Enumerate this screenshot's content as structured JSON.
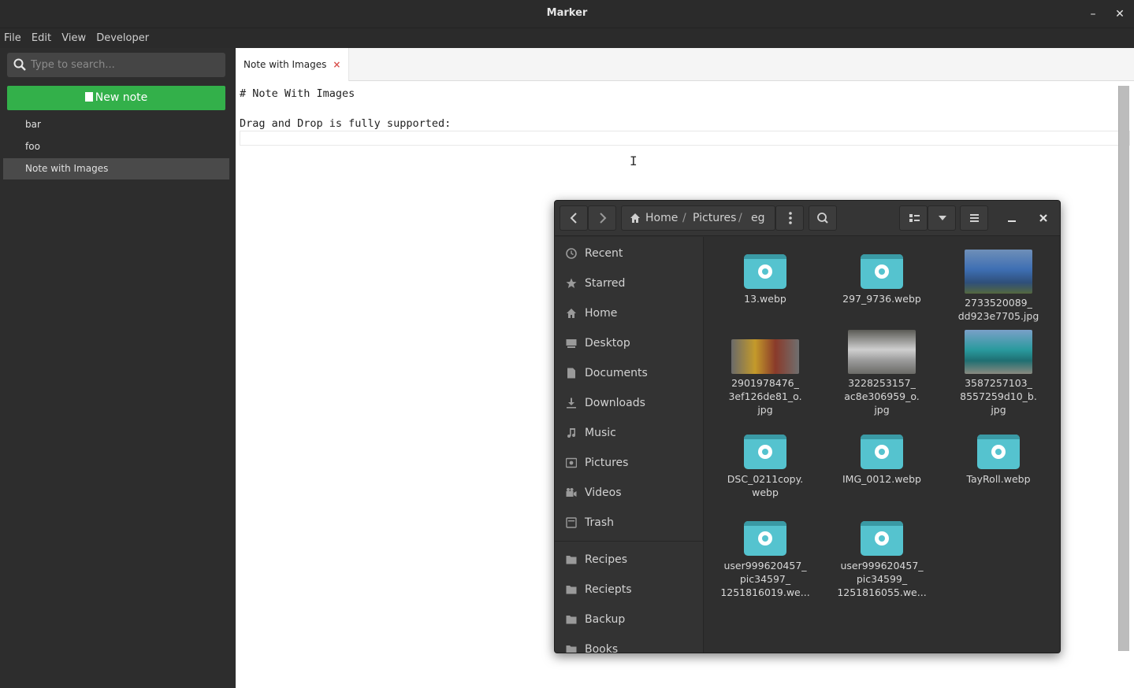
{
  "window": {
    "title": "Marker",
    "minimize_glyph": "–",
    "close_glyph": "✕"
  },
  "menu": [
    "File",
    "Edit",
    "View",
    "Developer"
  ],
  "sidebar": {
    "search_placeholder": "Type to search...",
    "new_note_label": "New note",
    "notes": [
      "bar",
      "foo",
      "Note with Images"
    ],
    "active_note": "Note with Images"
  },
  "tab": {
    "label": "Note with Images",
    "close_glyph": "×"
  },
  "editor": {
    "lines": [
      "# Note With Images",
      "",
      "Drag and Drop is fully supported:"
    ]
  },
  "dialog": {
    "breadcrumbs": [
      "Home",
      "Pictures",
      "eg"
    ],
    "crumb_separator": "/",
    "places": [
      "Recent",
      "Starred",
      "Home",
      "Desktop",
      "Documents",
      "Downloads",
      "Music",
      "Pictures",
      "Videos",
      "Trash"
    ],
    "bookmarks": [
      "Recipes",
      "Reciepts",
      "Backup",
      "Books"
    ],
    "files": [
      {
        "name": "13.webp",
        "kind": "image-icon"
      },
      {
        "name": "297_9736.webp",
        "kind": "image-icon"
      },
      {
        "name": "2733520089_\ndd923e7705.jpg",
        "kind": "thumbnail",
        "color": "#3e6fb3"
      },
      {
        "name": "2901978476_\n3ef126de81_o.\njpg",
        "kind": "thumbnail",
        "color": "#8a6a3a"
      },
      {
        "name": "3228253157_\nac8e306959_o.\njpg",
        "kind": "thumbnail",
        "color": "#8e8e8e"
      },
      {
        "name": "3587257103_\n8557259d10_b.\njpg",
        "kind": "thumbnail",
        "color": "#2a9a9e"
      },
      {
        "name": "DSC_0211copy.\nwebp",
        "kind": "image-icon"
      },
      {
        "name": "IMG_0012.webp",
        "kind": "image-icon"
      },
      {
        "name": "TayRoll.webp",
        "kind": "image-icon"
      },
      {
        "name": "user999620457_\npic34597_\n1251816019.we...",
        "kind": "image-icon"
      },
      {
        "name": "user999620457_\npic34599_\n1251816055.we...",
        "kind": "image-icon"
      }
    ]
  },
  "colors": {
    "accent_green": "#33b04a",
    "tab_close": "#d9534f",
    "image_icon": "#55c3cf"
  }
}
